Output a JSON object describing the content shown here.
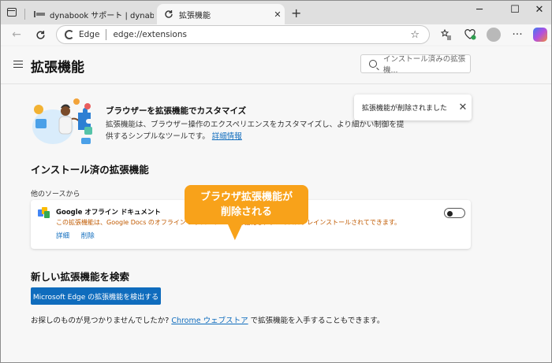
{
  "tabs": [
    {
      "title": "dynabook サポート | dynabook (ダ",
      "active": false
    },
    {
      "title": "拡張機能",
      "active": true
    }
  ],
  "address_bar": {
    "brand": "Edge",
    "url": "edge://extensions"
  },
  "page": {
    "title": "拡張機能",
    "search_placeholder": "インストール済みの拡張機..."
  },
  "toast": {
    "message": "拡張機能が削除されました"
  },
  "promo": {
    "title": "ブラウザーを拡張機能でカスタマイズ",
    "text": "拡張機能は、ブラウザー操作のエクスペリエンスをカスタマイズし、より細かい制御を提供するシンプルなツールです。",
    "link": "詳細情報"
  },
  "installed": {
    "heading": "インストール済の拡張機能",
    "source_label": "他のソースから",
    "extension": {
      "name": "Google オフライン ドキュメント",
      "description": "この拡張機能は、Google Docs のオフライン エクスペリエンスを強化し、デバイスにプレインストールされてできます。",
      "details_label": "詳細",
      "remove_label": "削除"
    }
  },
  "find_new": {
    "heading": "新しい拡張機能を検索",
    "button_label": "Microsoft Edge の拡張機能を検出する",
    "footer_prefix": "お探しのものが見つかりませんでしたか?",
    "footer_link": "Chrome ウェブストア",
    "footer_suffix": "で拡張機能を入手することもできます。"
  },
  "callout": {
    "line1": "ブラウザ拡張機能が",
    "line2": "削除される"
  },
  "colors": {
    "accent": "#0f6cbd",
    "callout": "#f8a21a",
    "warning_text": "#c05a00"
  }
}
